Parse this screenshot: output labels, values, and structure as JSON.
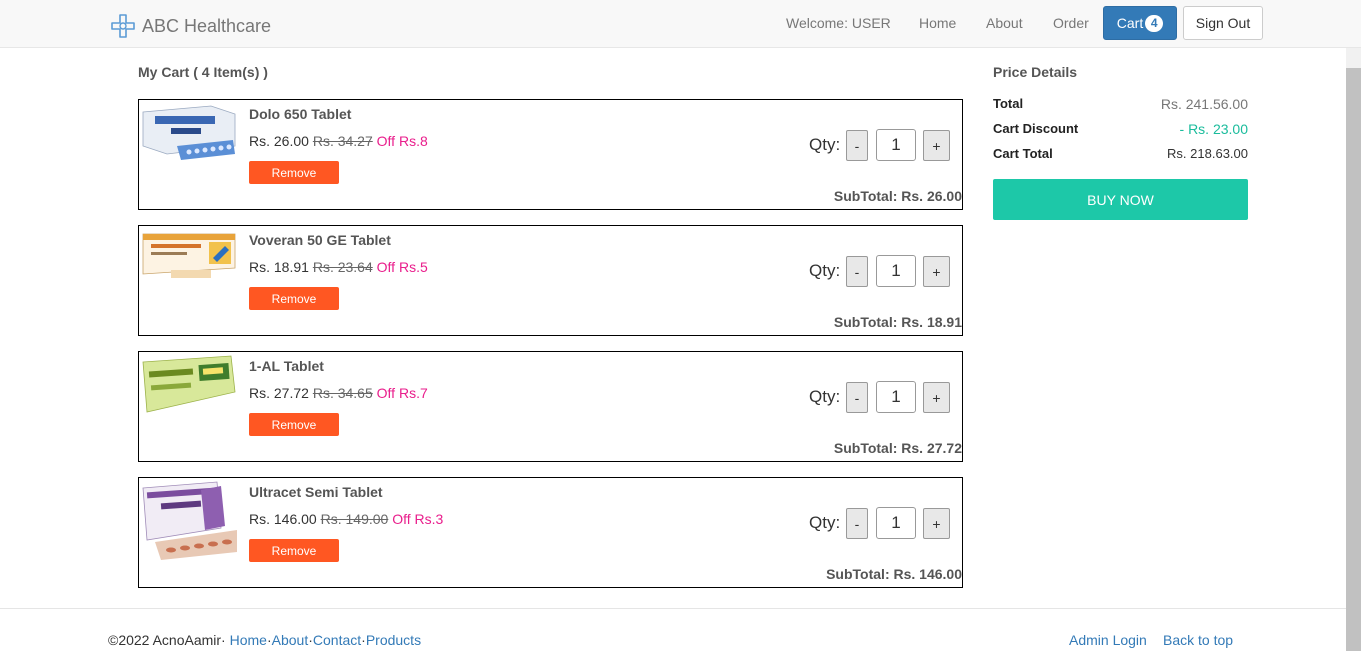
{
  "navbar": {
    "brand": "ABC Healthcare",
    "welcome": "Welcome: USER",
    "links": [
      "Home",
      "About",
      "Order"
    ],
    "cart_label": "Cart",
    "cart_count": "4",
    "signout_label": "Sign Out"
  },
  "cart": {
    "title": "My Cart ( 4 Item(s) )",
    "qty_label": "Qty:",
    "minus": "-",
    "plus": "+",
    "remove_label": "Remove",
    "items": [
      {
        "name": "Dolo 650 Tablet",
        "price": "Rs.  26.00",
        "old_price": "Rs.  34.27",
        "off": "Off Rs.8",
        "qty": "1",
        "subtotal": "SubTotal: Rs.  26.00"
      },
      {
        "name": "Voveran 50 GE Tablet",
        "price": "Rs.  18.91",
        "old_price": "Rs.  23.64",
        "off": "Off Rs.5",
        "qty": "1",
        "subtotal": "SubTotal: Rs.  18.91"
      },
      {
        "name": "1-AL Tablet",
        "price": "Rs.  27.72",
        "old_price": "Rs.  34.65",
        "off": "Off Rs.7",
        "qty": "1",
        "subtotal": "SubTotal: Rs.  27.72"
      },
      {
        "name": "Ultracet Semi Tablet",
        "price": "Rs.  146.00",
        "old_price": "Rs.  149.00",
        "off": "Off Rs.3",
        "qty": "1",
        "subtotal": "SubTotal: Rs.  146.00"
      }
    ]
  },
  "price_details": {
    "title": "Price Details",
    "total_label": "Total",
    "total_value": "Rs. 241.56.00",
    "discount_label": "Cart Discount",
    "discount_value": "- Rs. 23.00",
    "cart_total_label": "Cart Total",
    "cart_total_value": "Rs. 218.63.00",
    "buy_label": "BUY NOW"
  },
  "footer": {
    "copyright": "©2022 AcnoAamir",
    "links": [
      "Home",
      "About",
      "Contact",
      "Products"
    ],
    "admin_login": "Admin Login",
    "back_to_top": "Back to top"
  },
  "colors": {
    "primary": "#337ab7",
    "remove": "#ff5722",
    "buy": "#1dc8a8",
    "discount": "#1abc9c",
    "off": "#e91e8c"
  }
}
